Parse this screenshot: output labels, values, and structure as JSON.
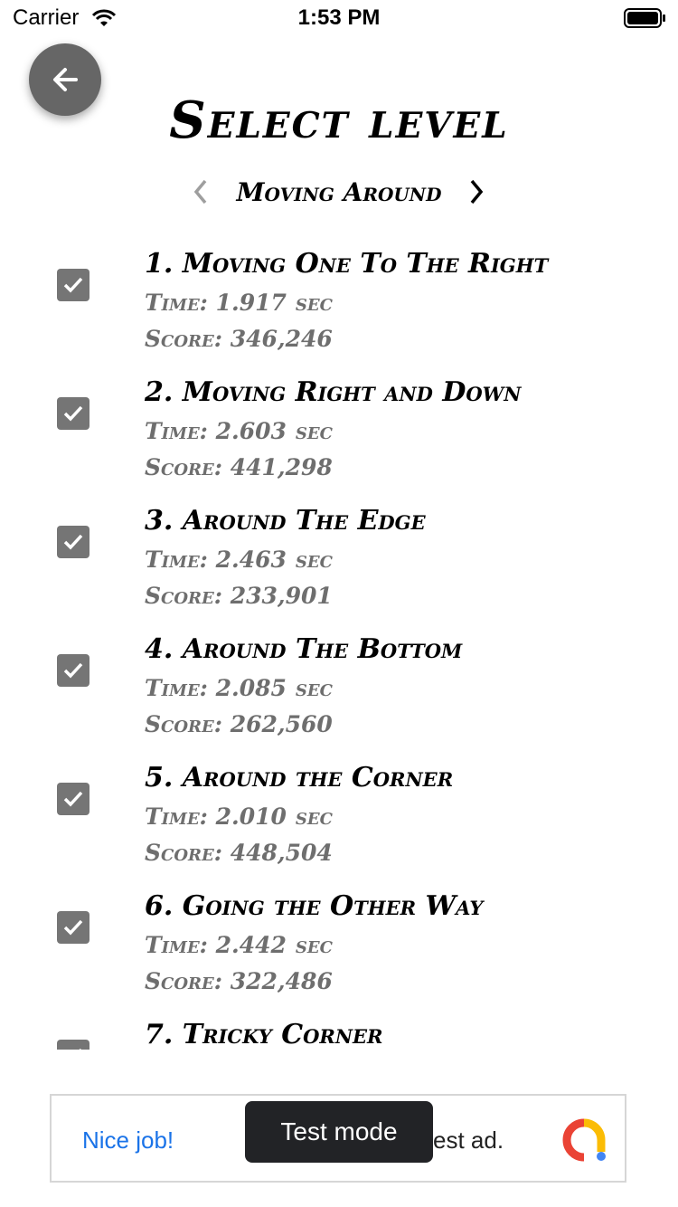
{
  "status_bar": {
    "carrier": "Carrier",
    "time": "1:53 PM"
  },
  "header": {
    "title": "Select level",
    "category": "Moving Around"
  },
  "levels": [
    {
      "title": "1. Moving One To The Right",
      "time_label": "Time:",
      "time": "1.917",
      "unit": "sec",
      "score_label": "Score:",
      "score": "346,246",
      "completed": true
    },
    {
      "title": "2. Moving Right and Down",
      "time_label": "Time:",
      "time": "2.603",
      "unit": "sec",
      "score_label": "Score:",
      "score": "441,298",
      "completed": true
    },
    {
      "title": "3. Around The Edge",
      "time_label": "Time:",
      "time": "2.463",
      "unit": "sec",
      "score_label": "Score:",
      "score": "233,901",
      "completed": true
    },
    {
      "title": "4. Around The Bottom",
      "time_label": "Time:",
      "time": "2.085",
      "unit": "sec",
      "score_label": "Score:",
      "score": "262,560",
      "completed": true
    },
    {
      "title": "5. Around the Corner",
      "time_label": "Time:",
      "time": "2.010",
      "unit": "sec",
      "score_label": "Score:",
      "score": "448,504",
      "completed": true
    },
    {
      "title": "6. Going the Other Way",
      "time_label": "Time:",
      "time": "2.442",
      "unit": "sec",
      "score_label": "Score:",
      "score": "322,486",
      "completed": true
    },
    {
      "title": "7. Tricky Corner",
      "completed": true
    }
  ],
  "ad": {
    "label": "Nice job!",
    "text": "est ad.",
    "toast": "Test mode"
  },
  "colors": {
    "accent": "#1a73e8",
    "checkbox": "#757575",
    "back_button": "#666666"
  },
  "icons": [
    "back-arrow-icon",
    "chevron-left-icon",
    "chevron-right-icon",
    "checkmark-icon",
    "wifi-icon",
    "battery-icon",
    "admob-logo-icon"
  ]
}
